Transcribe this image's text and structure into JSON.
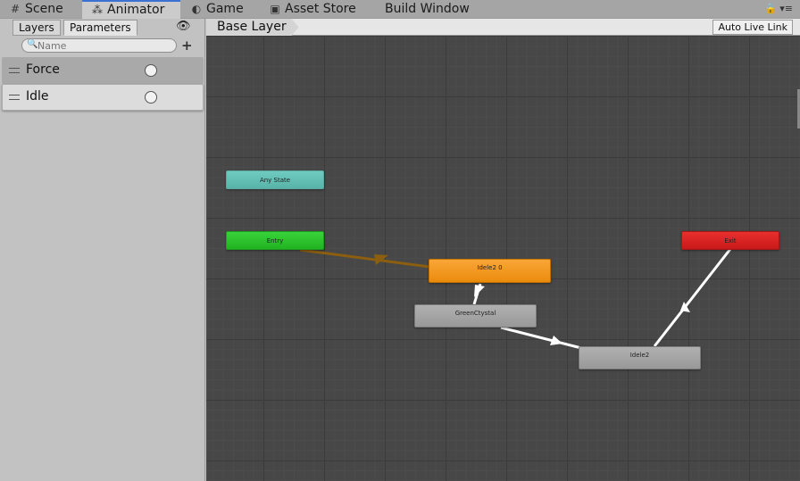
{
  "tabs": {
    "scene": "Scene",
    "animator": "Animator",
    "game": "Game",
    "asset_store": "Asset Store",
    "build_window": "Build Window"
  },
  "left_panel": {
    "tabs": {
      "layers": "Layers",
      "parameters": "Parameters"
    },
    "search": {
      "placeholder": "Name"
    },
    "parameters": [
      {
        "name": "Force",
        "type": "trigger"
      },
      {
        "name": "Idle",
        "type": "trigger"
      }
    ]
  },
  "graph": {
    "breadcrumb": "Base Layer",
    "auto_live_link": "Auto Live Link",
    "nodes": {
      "any_state": "Any State",
      "entry": "Entry",
      "exit": "Exit",
      "idele2_0": "Idele2 0",
      "green_ctystal": "GreenCtystal",
      "idele2": "Idele2"
    }
  },
  "colors": {
    "accent": "#3a72d4",
    "any_state": "#62bfb4",
    "entry": "#2bc22b",
    "exit": "#d92422",
    "default_state": "#eb8b0d",
    "state": "#a5a5a5",
    "graph_bg": "#474747"
  }
}
